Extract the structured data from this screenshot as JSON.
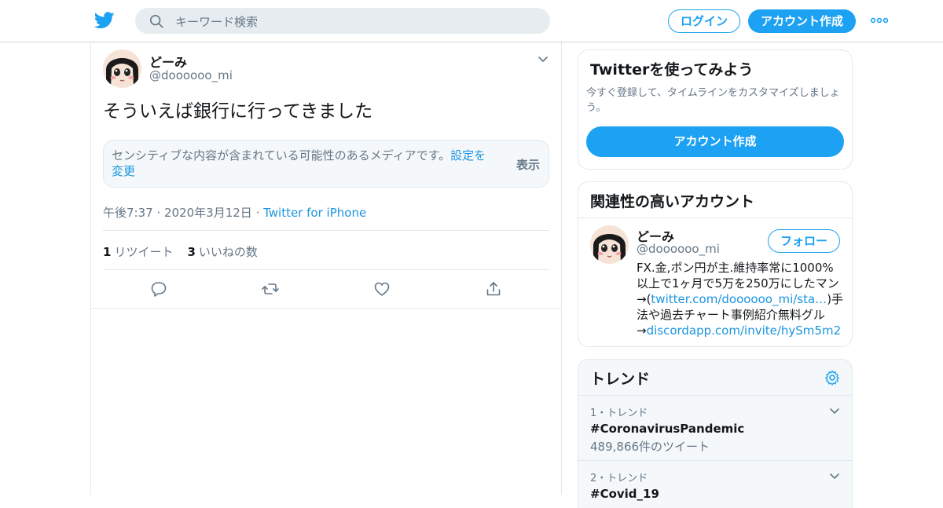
{
  "header": {
    "search_placeholder": "キーワード検索",
    "login_label": "ログイン",
    "signup_label": "アカウント作成"
  },
  "tweet": {
    "name": "どーみ",
    "handle": "@doooooo_mi",
    "text": "そういえば銀行に行ってきました",
    "sensitive_message": "センシティブな内容が含まれている可能性のあるメディアです。",
    "sensitive_settings_link": "設定を変更",
    "show_label": "表示",
    "timestamp": "午後7:37 · 2020年3月12日",
    "meta_sep": " · ",
    "source": "Twitter for iPhone",
    "retweet_count": "1",
    "retweet_label": "リツイート",
    "like_count": "3",
    "like_label": "いいねの数"
  },
  "sidebar": {
    "try_card": {
      "title": "Twitterを使ってみよう",
      "description": "今すぐ登録して、タイムラインをカスタマイズしましょう。",
      "button": "アカウント作成"
    },
    "related": {
      "title": "関連性の高いアカウント",
      "name": "どーみ",
      "handle": "@doooooo_mi",
      "follow_label": "フォロー",
      "bio_1": "FX.金,ポン円が主.維持率常に1000%以上で1ヶ月で5万を250万にしたマン→(",
      "bio_link_1": "twitter.com/doooooo_mi/sta…",
      "bio_2": ")手法や過去チャート事例紹介無料グル→",
      "bio_link_2": "discordapp.com/invite/hySm5m2"
    },
    "trends": {
      "title": "トレンド",
      "items": [
        {
          "rank": "1・トレンド",
          "tag": "#CoronavirusPandemic",
          "count": "489,866件のツイート"
        },
        {
          "rank": "2・トレンド",
          "tag": "#Covid_19",
          "count": ""
        }
      ]
    }
  },
  "colors": {
    "accent": "#1da1f2",
    "link": "#1b95e0",
    "muted": "#657786"
  }
}
